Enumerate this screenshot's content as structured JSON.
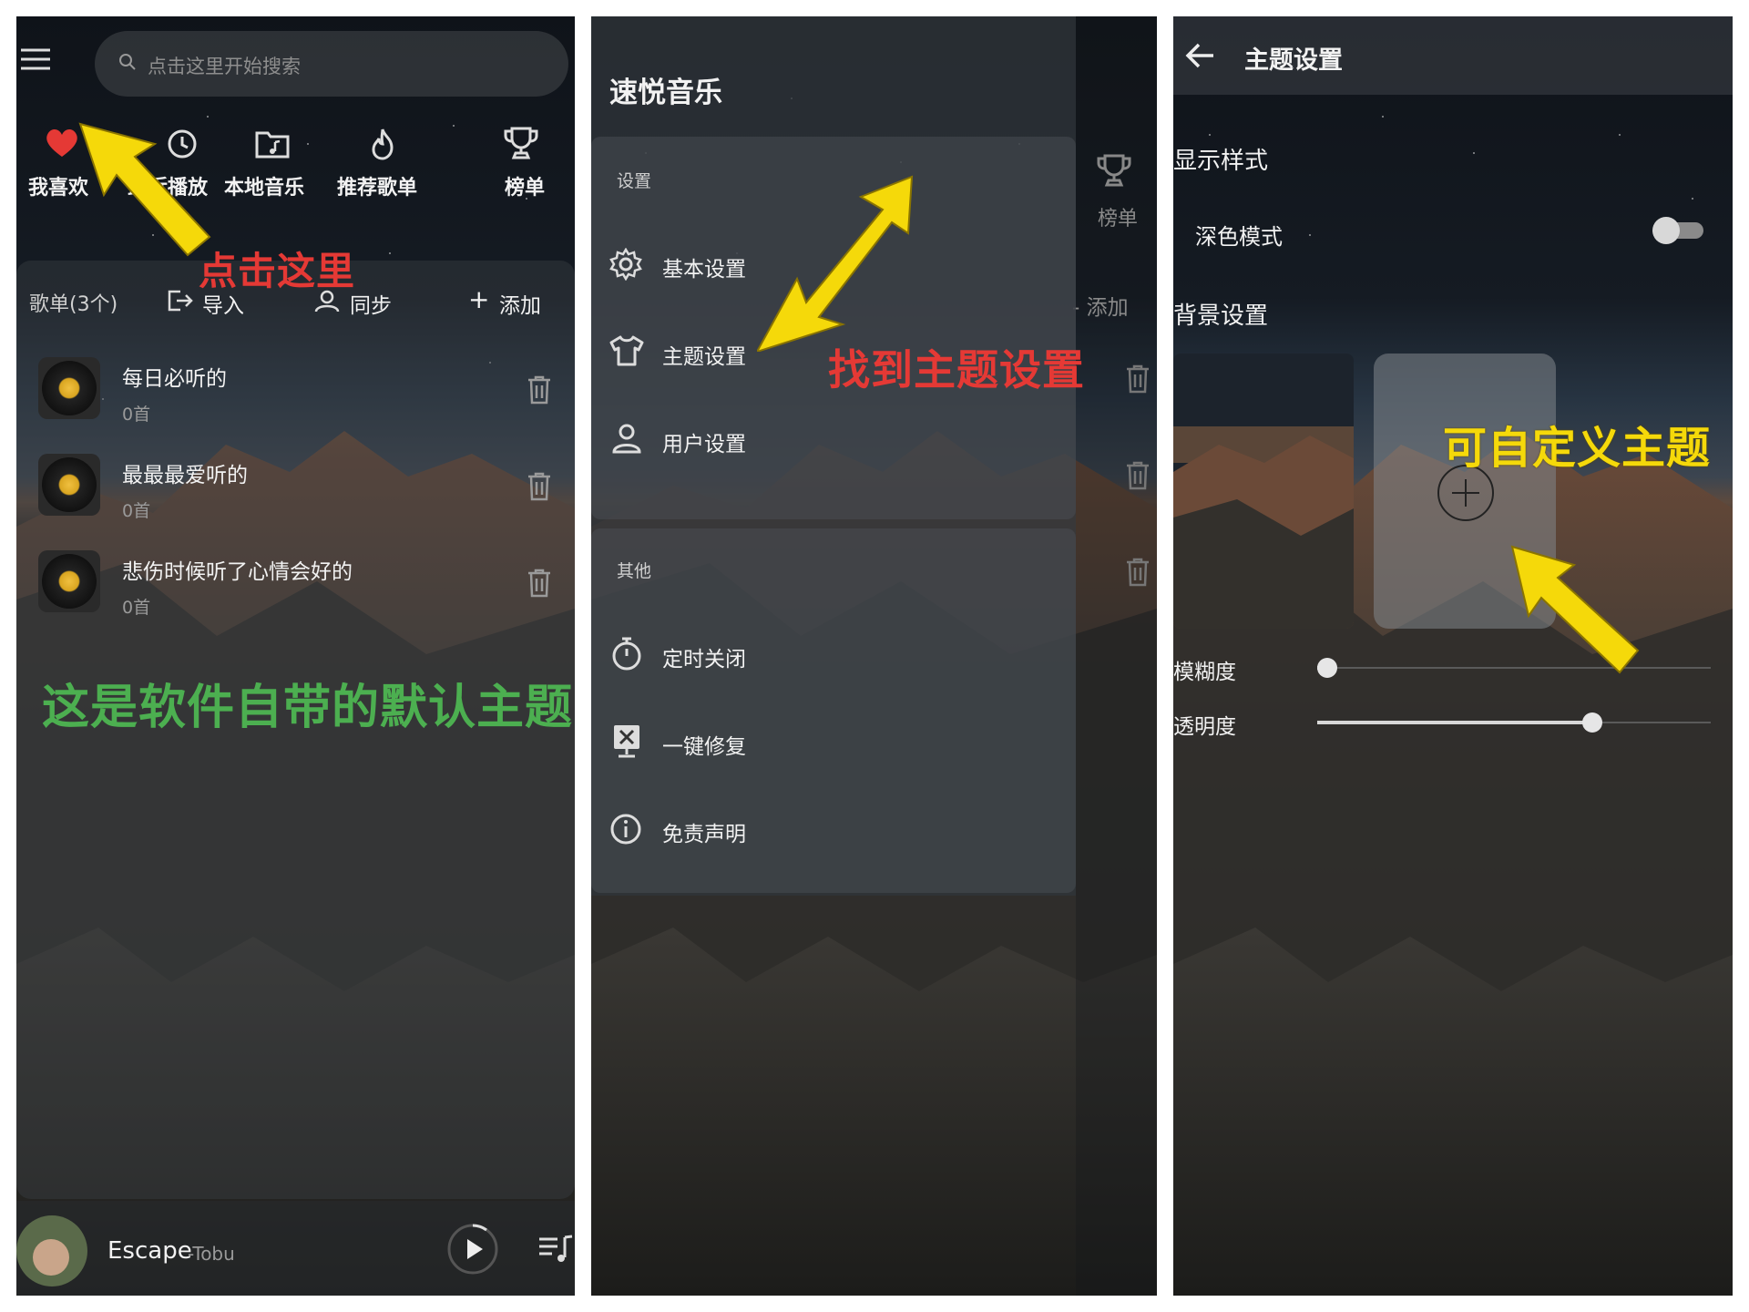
{
  "left_panel": {
    "search_placeholder": "点击这里开始搜索",
    "quick_nav": [
      {
        "label": "我喜欢",
        "icon": "heart-icon"
      },
      {
        "label": "最近播放",
        "icon": "clock-icon"
      },
      {
        "label": "本地音乐",
        "icon": "folder-music-icon"
      },
      {
        "label": "推荐歌单",
        "icon": "flame-icon"
      },
      {
        "label": "榜单",
        "icon": "trophy-icon"
      }
    ],
    "playlist_header": {
      "title": "歌单(3个)",
      "import_label": "导入",
      "sync_label": "同步",
      "add_label": "添加"
    },
    "playlists": [
      {
        "name": "每日必听的",
        "count": "0首"
      },
      {
        "name": "最最最爱听的",
        "count": "0首"
      },
      {
        "name": "悲伤时候听了心情会好的",
        "count": "0首"
      }
    ],
    "player": {
      "song": "Escape",
      "artist": "-Tobu"
    }
  },
  "middle_panel": {
    "app_title": "速悦音乐",
    "settings_section": "设置",
    "settings_items": [
      "基本设置",
      "主题设置",
      "用户设置"
    ],
    "other_section": "其他",
    "other_items": [
      "定时关闭",
      "一键修复",
      "免责声明"
    ],
    "bg_rank_label": "榜单",
    "bg_add_label": "添加"
  },
  "right_panel": {
    "title": "主题设置",
    "display_section": "显示样式",
    "dark_mode_label": "深色模式",
    "dark_mode_on": false,
    "background_section": "背景设置",
    "blur_label": "模糊度",
    "blur_value": 0.0,
    "opacity_label": "透明度",
    "opacity_value": 0.71
  },
  "annotations": {
    "click_here": "点击这里",
    "default_theme": "这是软件自带的默认主题",
    "find_theme": "找到主题设置",
    "custom_theme": "可自定义主题"
  },
  "colors": {
    "annotation_red": "#e53935",
    "annotation_green": "#4caf50",
    "annotation_yellow": "#f5d90a",
    "heart_red": "#e53935"
  }
}
